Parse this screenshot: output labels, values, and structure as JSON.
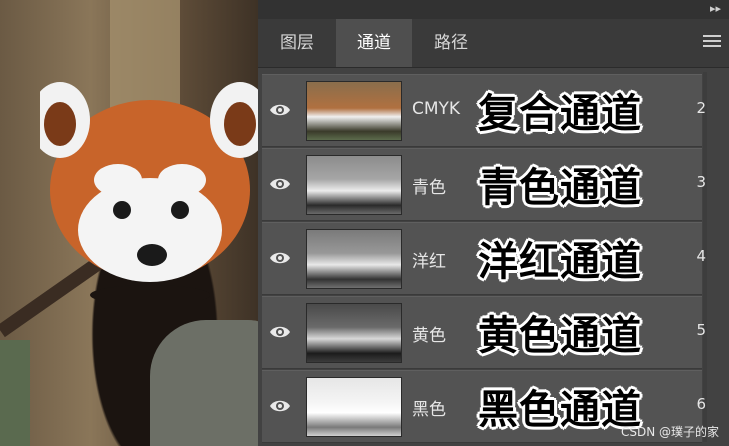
{
  "panel": {
    "tabs": [
      {
        "label": "图层",
        "active": false
      },
      {
        "label": "通道",
        "active": true
      },
      {
        "label": "路径",
        "active": false
      }
    ],
    "collapse_icon": "double-chevron-right-icon",
    "menu_icon": "hamburger-menu-icon"
  },
  "channels": [
    {
      "name": "CMYK",
      "annotation": "复合通道",
      "shortcut": "2",
      "thumb": "color"
    },
    {
      "name": "青色",
      "annotation": "青色通道",
      "shortcut": "3",
      "thumb": "gray-mid"
    },
    {
      "name": "洋红",
      "annotation": "洋红通道",
      "shortcut": "4",
      "thumb": "gray-mid"
    },
    {
      "name": "黄色",
      "annotation": "黄色通道",
      "shortcut": "5",
      "thumb": "gray-dark"
    },
    {
      "name": "黑色",
      "annotation": "黑色通道",
      "shortcut": "6",
      "thumb": "gray-light"
    }
  ],
  "watermark": "CSDN @璞子的家",
  "colors": {
    "panel_bg": "#424242",
    "row_bg": "#535353",
    "tab_active": "#4f4f4f"
  }
}
